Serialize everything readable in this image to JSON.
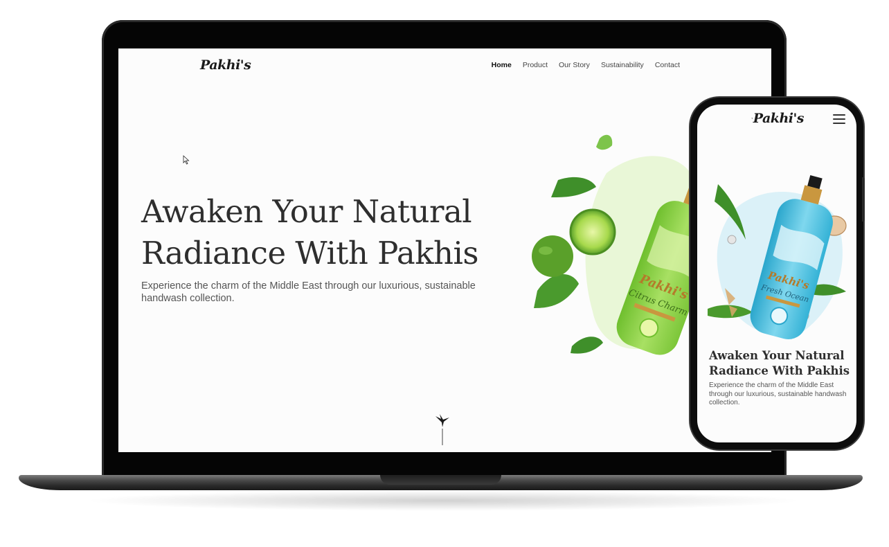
{
  "brand": {
    "logo_text": "Pakhi's"
  },
  "nav": {
    "items": [
      {
        "label": "Home",
        "active": true
      },
      {
        "label": "Product",
        "active": false
      },
      {
        "label": "Our Story",
        "active": false
      },
      {
        "label": "Sustainability",
        "active": false
      },
      {
        "label": "Contact",
        "active": false
      }
    ]
  },
  "hero": {
    "title_line1": "Awaken Your Natural",
    "title_line2": "Radiance With Pakhis",
    "subtitle": "Experience the charm of the Middle East through our luxurious, sustainable handwash collection."
  },
  "desktop_product": {
    "brand": "Pakhi's",
    "variant": "Citrus Charm"
  },
  "mobile": {
    "title_line1": "Awaken Your Natural",
    "title_line2": "Radiance With Pakhis",
    "subtitle": "Experience the charm of the Middle East through our luxurious, sustainable handwash collection.",
    "product_brand": "Pakhi's",
    "product_variant": "Fresh Ocean"
  },
  "colors": {
    "device_black": "#050505",
    "lime_green": "#8fd14f",
    "ocean_blue": "#3fb6d9",
    "pump_gold": "#c9973f"
  },
  "icons": [
    "bird-logo-icon",
    "hamburger-menu-icon",
    "mouse-cursor-icon",
    "scroll-bird-icon"
  ]
}
